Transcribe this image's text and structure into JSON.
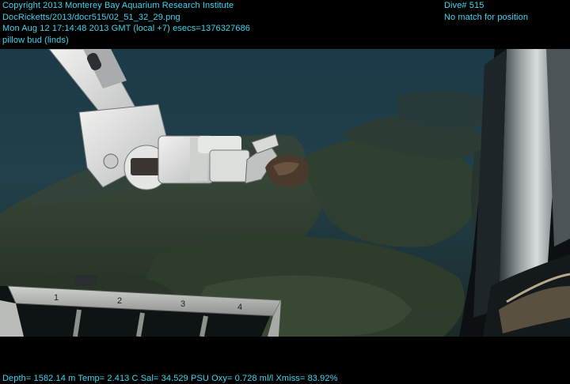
{
  "overlay": {
    "copyright": "Copyright 2013 Monterey Bay Aquarium Research Institute",
    "file_path": "DocRicketts/2013/docr515/02_51_32_29.png",
    "timestamp": "Mon Aug 12 17:14:48 2013 GMT (local +7)  esecs=1376327686",
    "annotation": "pillow bud (linds)",
    "dive": "Dive# 515",
    "position_status": "No match for position",
    "telemetry": "Depth= 1582.14 m  Temp= 2.413 C  Sal= 34.529 PSU  Oxy= 0.728 ml/l  Xmiss= 83.92%"
  },
  "tray_labels": [
    "1",
    "2",
    "3",
    "4"
  ],
  "colors": {
    "overlay_text": "#3fd6f0",
    "water": "#1e3a45",
    "seafloor": "#2e3d2e"
  }
}
